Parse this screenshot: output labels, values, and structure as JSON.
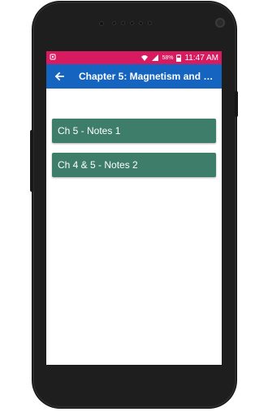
{
  "status_bar": {
    "battery_percent": "58%",
    "time": "11:47 AM"
  },
  "toolbar": {
    "back_icon": "arrow-left-icon",
    "title": "Chapter 5: Magnetism and M..."
  },
  "items": [
    {
      "label": "Ch 5 - Notes 1"
    },
    {
      "label": "Ch 4 & 5 - Notes 2"
    }
  ],
  "colors": {
    "status_bar": "#d81b60",
    "toolbar": "#1565c0",
    "card": "#3e7d6a"
  }
}
